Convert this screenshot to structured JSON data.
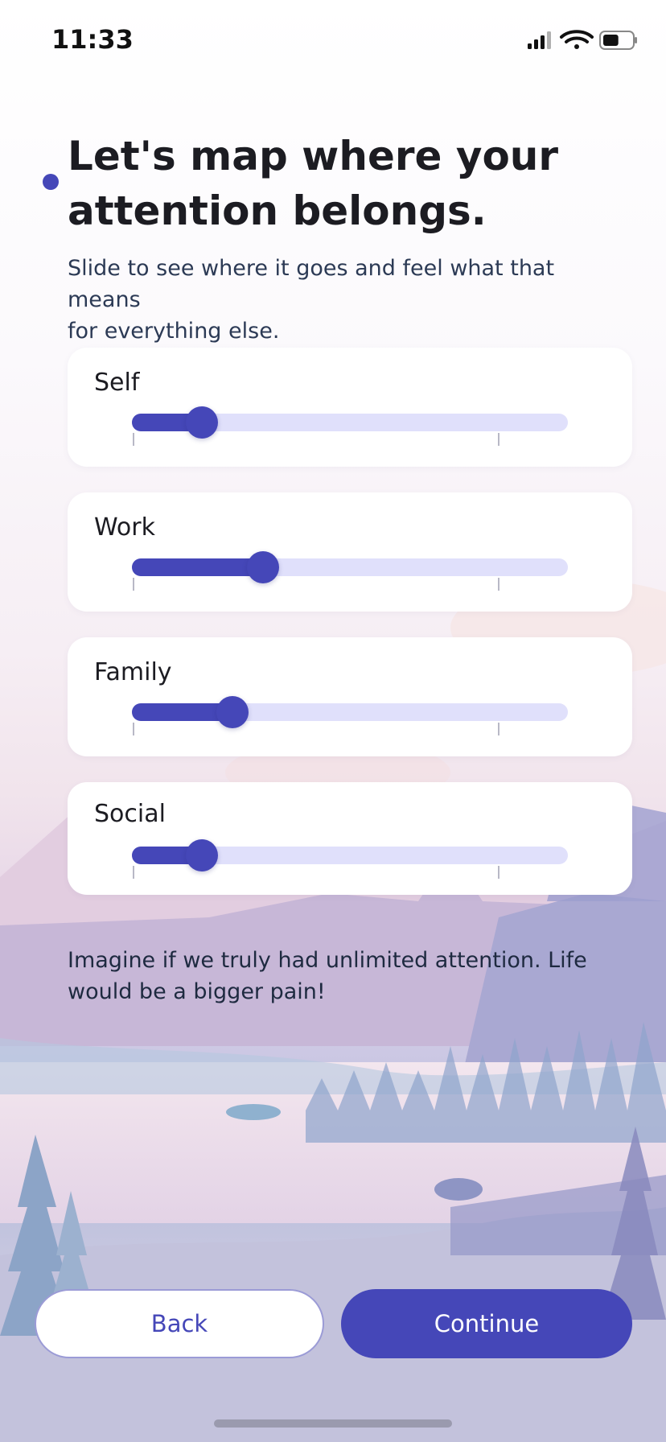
{
  "status_bar": {
    "time": "11:33",
    "icons": [
      "cellular-signal-icon",
      "wifi-icon",
      "battery-icon"
    ],
    "battery_level": 0.55
  },
  "progress_indicator": {
    "icon": "dot-icon",
    "color": "#4547b8"
  },
  "header": {
    "title": "Let's map where your\nattention belongs.",
    "subtitle": "Slide to see where it goes and feel what that means\nfor everything else."
  },
  "sliders": [
    {
      "label": "Self",
      "value": 0.16
    },
    {
      "label": "Work",
      "value": 0.3
    },
    {
      "label": "Family",
      "value": 0.23
    },
    {
      "label": "Social",
      "value": 0.16
    }
  ],
  "info_text": "Imagine if we truly had unlimited attention. Life\nwould be a bigger pain!",
  "buttons": {
    "back": "Back",
    "continue": "Continue"
  },
  "colors": {
    "accent": "#4547b8",
    "track": "#e0e0fb",
    "card": "#ffffff",
    "title": "#1c1c22"
  }
}
